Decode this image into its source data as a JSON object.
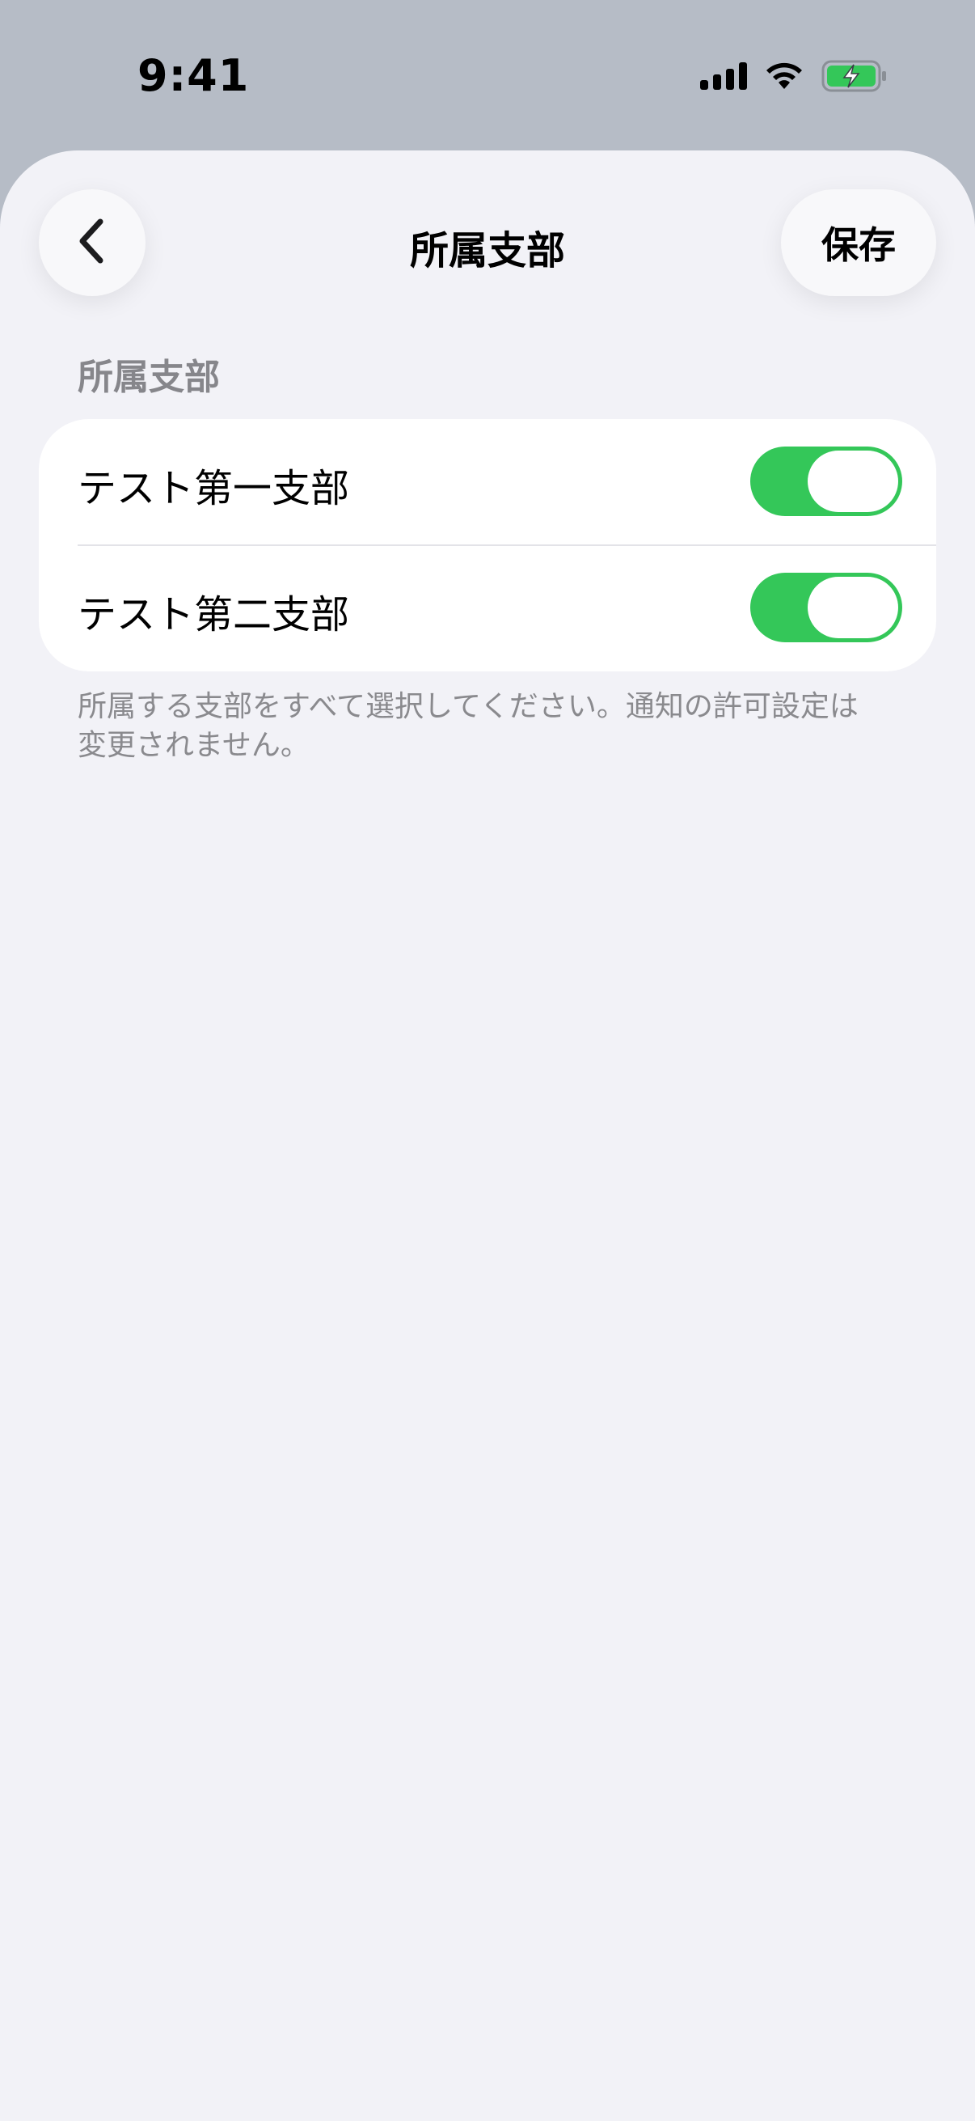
{
  "status_bar": {
    "time": "9:41",
    "icons": [
      "cellular-signal-icon",
      "wifi-icon",
      "battery-charging-icon"
    ]
  },
  "nav": {
    "back_icon": "chevron-left-icon",
    "title": "所属支部",
    "save_label": "保存"
  },
  "section": {
    "header": "所属支部",
    "items": [
      {
        "label": "テスト第一支部",
        "enabled": true
      },
      {
        "label": "テスト第二支部",
        "enabled": true
      }
    ],
    "footer": "所属する支部をすべて選択してください。通知の許可設定は変更されません。"
  },
  "colors": {
    "toggle_on": "#34c759",
    "battery": "#34c759"
  }
}
